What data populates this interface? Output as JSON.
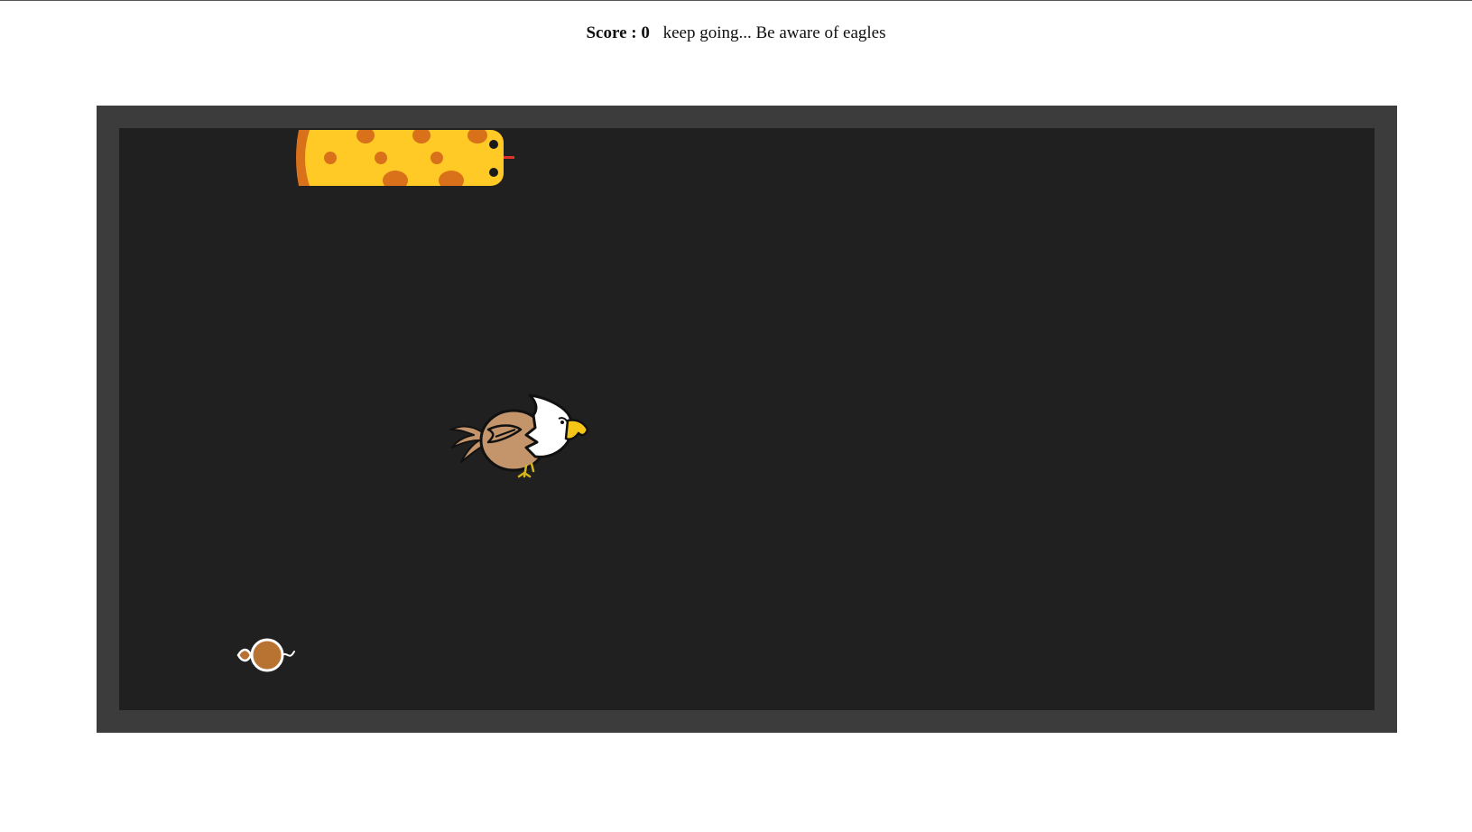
{
  "header": {
    "score_label": "Score :",
    "score_value": "0",
    "message": "keep going... Be aware of eagles"
  },
  "game": {
    "snake": {
      "icon": "snake-icon",
      "body_color": "#ffc926",
      "spot_color": "#d9711a",
      "tongue_color": "#e0322a"
    },
    "eagle": {
      "icon": "eagle-icon",
      "body_color": "#c4946a",
      "head_color": "#ffffff",
      "beak_color": "#f5c518"
    },
    "food": {
      "icon": "mouse-icon",
      "color": "#b87333"
    },
    "colors": {
      "frame": "#3c3c3c",
      "board": "#202020"
    }
  }
}
